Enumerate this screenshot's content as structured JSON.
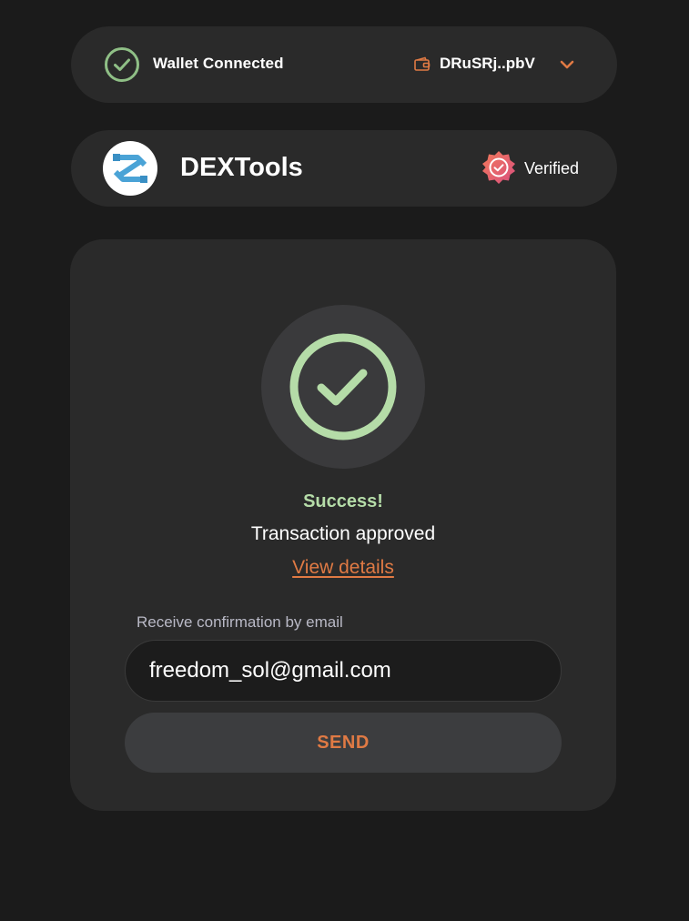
{
  "wallet": {
    "status": "Wallet Connected",
    "address": "DRuSRj..pbV",
    "status_icon": "check-circle-icon",
    "wallet_icon": "wallet-icon",
    "menu_icon": "chevron-down-icon"
  },
  "app": {
    "name": "DEXTools",
    "verified_label": "Verified",
    "logo_icon": "dextools-logo",
    "verified_icon": "verified-badge-icon"
  },
  "result": {
    "title": "Success!",
    "message": "Transaction approved",
    "details_link": "View details",
    "icon": "success-check-icon"
  },
  "email": {
    "label": "Receive confirmation by email",
    "value": "freedom_sol@gmail.com",
    "send_label": "SEND"
  },
  "colors": {
    "background": "#1b1b1b",
    "card": "#2a2a2a",
    "accent": "#e07a44",
    "success": "#b5dca8",
    "wallet_check": "#8fbf86"
  }
}
